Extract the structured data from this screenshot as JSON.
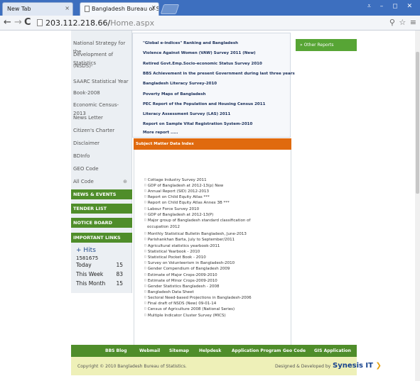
{
  "browser": {
    "tabs": [
      {
        "title": "New Tab",
        "close": "×"
      },
      {
        "title": "Bangladesh Bureau of Statis",
        "close": "X"
      }
    ],
    "window_controls": "⩡ – ◻ ✕",
    "nav": {
      "back": "←",
      "forward": "→",
      "reload": "C"
    },
    "url_host": "203.112.218.66/",
    "url_path": "Home.aspx",
    "toolbar_icons": "⚲ ☆ ≡"
  },
  "sidebar": {
    "links": [
      "National Strategy for the",
      "Development of Statistics",
      "(NSDS)-",
      "SAARC Statistical Year",
      "Book-2008",
      "Economic Census-2013",
      "News Letter",
      "Citizen's Charter",
      "Disclaimer",
      "BDInfo",
      "GEO Code",
      "All Code"
    ],
    "expand_icon": "⊕",
    "sections": [
      "NEWS & EVENTS",
      "TENDER LIST",
      "NOTICE BOARD",
      "IMPORTANT LINKS"
    ],
    "hits": {
      "title": "+ Hits",
      "total": "1581675",
      "today_label": "Today",
      "today_value": "15",
      "week_label": "This Week",
      "week_value": "83",
      "month_label": "This Month",
      "month_value": "15"
    }
  },
  "reports": [
    "\"Global e-indices\" Ranking and Bangladesh",
    "Violence Against Women (VAW) Survey 2011 (New)",
    "Retired Govt.Emp.Socio-economic Status Survey 2010",
    "BBS Achievement in the present Government during last three years",
    "Bangladesh Literacy Survey-2010",
    "Poverty Maps of Bangladesh",
    "PEC Report of the Population and Housing Census 2011",
    "Literacy Assessment Survey (LAS) 2011",
    "Report on Sample Vital Registration System-2010",
    "More report ....."
  ],
  "subject_index": {
    "title": "Subject Matter Data Index",
    "items": [
      "Cottage Industry Survey 2011",
      "GDP of Bangladesh at 2012-13(p) New",
      "Annual Report (SID) 2012-2013",
      "Report on Child Equity Atlas ***",
      "Report on Child Equity Atlas Annex 3B ***",
      "Labour Force Survey 2010",
      "GDP of Bangladesh at 2012-13(P)",
      "Major group of Bangladesh standard classification of",
      "occupation 2012",
      "Monthly Statistical Bulletin Bangladesh, June-2013",
      "Parishankhan Barta, July to September/2011",
      "Agricultural statistics yearbook-2011",
      "Statistical Yearbook - 2010",
      "Statistical Pocket Book - 2010",
      "Survey on Volunteerism in Bangladesh-2010",
      "Gender Compendium of Bangladesh 2009",
      "Estimate of Major Crops-2009-2010",
      "Estimate of Minor Crops-2009-2010",
      "Gender Statistics Bangladesh - 2008",
      "Bangladesh Data Sheet",
      "Sectoral Need-based Projections in Bangladesh-2006",
      "Final draft of NSDS (New) 09-01-14",
      "Census of Agriculture 2008 (National Series)",
      "Multiple Indicator Cluster Survey (MICS)"
    ]
  },
  "other_reports": "» Other Reports",
  "footer_nav": [
    "BBS Blog",
    "Webmail",
    "Sitemap",
    "Helpdesk",
    "Application Program",
    "Geo Code",
    "GIS Application"
  ],
  "footer": {
    "copyright": "Copyright © 2010 Bangladesh Bureau of Statistics.",
    "designed_by": "Designed & Developed by",
    "company": "Synesis IT",
    "company_mark": "❯"
  },
  "colors": {
    "green": "#4f8d2a",
    "orange": "#e06a0e",
    "footer_bg": "#eef0b8",
    "tabstrip": "#3d6fbf"
  }
}
